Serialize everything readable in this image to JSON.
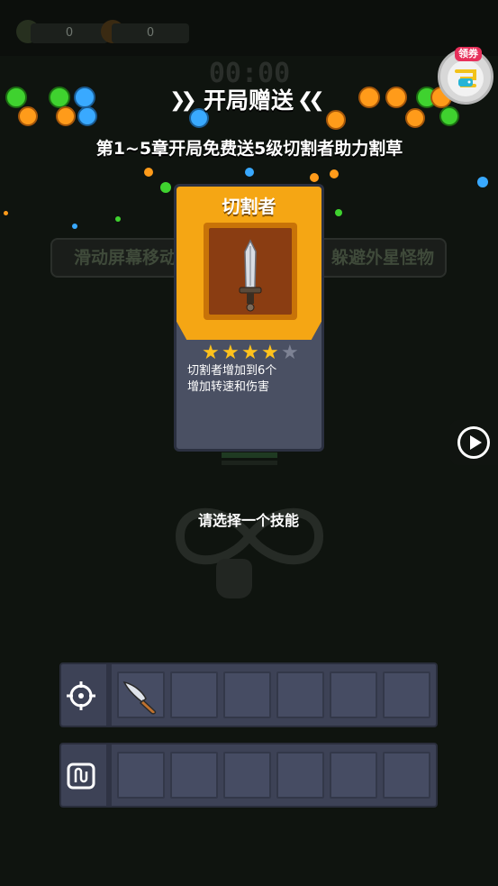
{
  "hud": {
    "kills": "0",
    "gold": "0",
    "timer": "00:00"
  },
  "coupon": {
    "badge": "领券"
  },
  "background_hints": {
    "left": "滑动屏幕移动",
    "right": "躲避外星怪物"
  },
  "gift": {
    "title": "开局赠送",
    "subtitle": "第1~5章开局免费送5级切割者助力割草"
  },
  "skill_card": {
    "name": "切割者",
    "stars_filled": 4,
    "stars_total": 5,
    "desc_line1": "切割者增加到6个",
    "desc_line2": "增加转速和伤害",
    "icon": "sword-icon"
  },
  "prompt": "请选择一个技能",
  "weapons_row": {
    "icon": "target-icon",
    "slots": [
      "knife-icon",
      "",
      "",
      "",
      "",
      ""
    ]
  },
  "passives_row": {
    "icon": "magnet-icon",
    "slots": [
      "",
      "",
      "",
      "",
      "",
      ""
    ]
  },
  "colors": {
    "card_orange": "#f5a614",
    "card_body": "#4a5063",
    "slot_bg": "#3d4256"
  }
}
